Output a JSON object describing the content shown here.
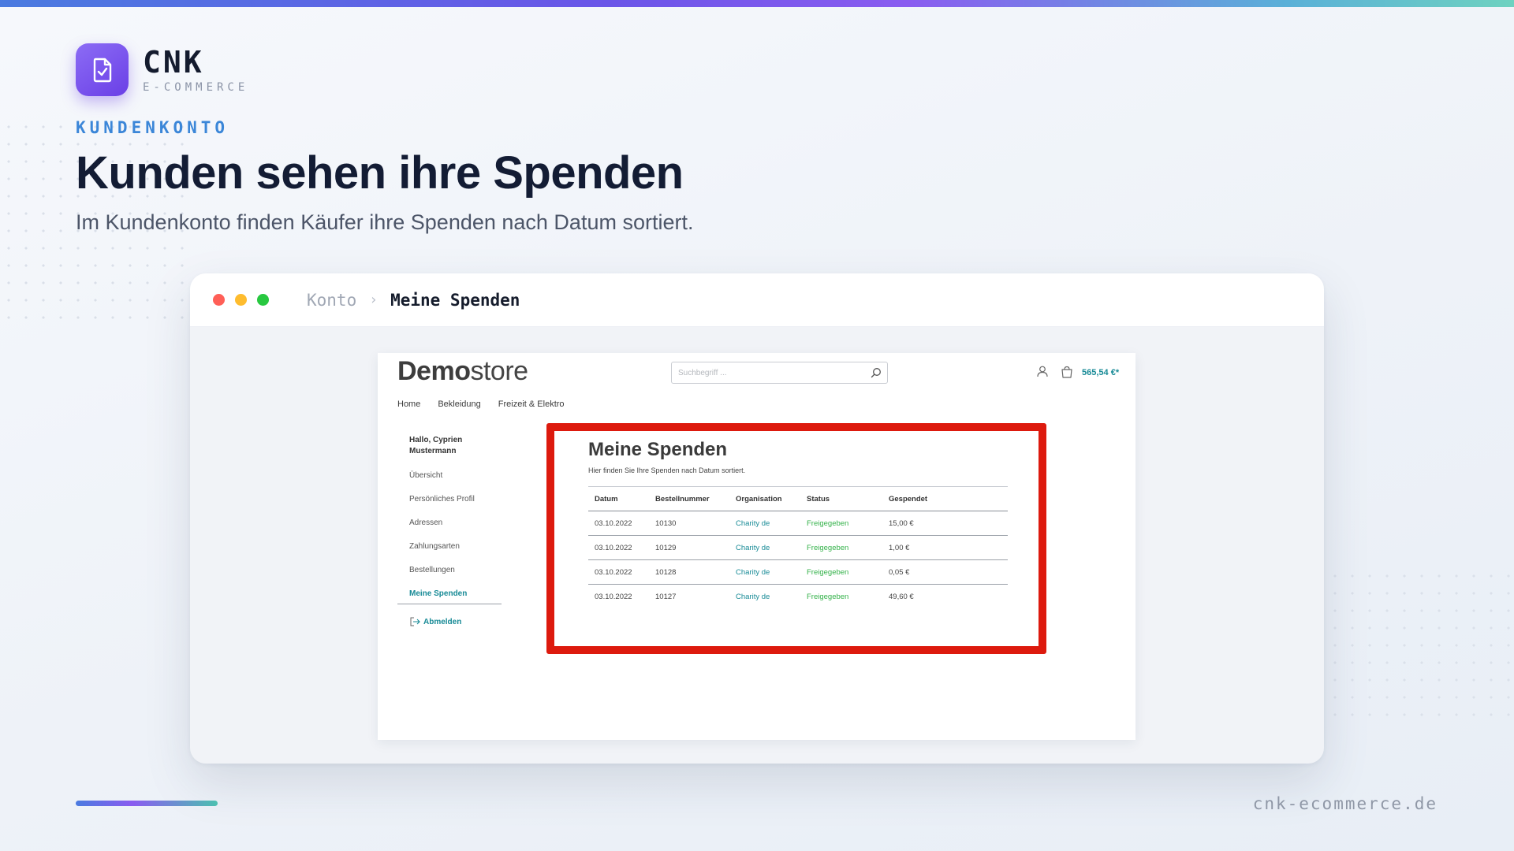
{
  "brand": {
    "name": "CNK",
    "tagline": "E-COMMERCE"
  },
  "hero": {
    "eyebrow": "KUNDENKONTO",
    "title": "Kunden sehen ihre Spenden",
    "subtitle": "Im Kundenkonto finden Käufer ihre Spenden nach Datum sortiert."
  },
  "window": {
    "breadcrumb": {
      "parent": "Konto",
      "separator": "›",
      "current": "Meine Spenden"
    }
  },
  "shop": {
    "logo_bold": "Demo",
    "logo_light": "store",
    "search_placeholder": "Suchbegriff ...",
    "cart_total": "565,54 €*",
    "nav": [
      "Home",
      "Bekleidung",
      "Freizeit & Elektro"
    ],
    "greeting": "Hallo, Cyprien Mustermann",
    "account_menu": [
      "Übersicht",
      "Persönliches Profil",
      "Adressen",
      "Zahlungsarten",
      "Bestellungen",
      "Meine Spenden"
    ],
    "logout": "Abmelden"
  },
  "donations": {
    "title": "Meine Spenden",
    "subtitle": "Hier finden Sie Ihre Spenden nach Datum sortiert.",
    "columns": [
      "Datum",
      "Bestellnummer",
      "Organisation",
      "Status",
      "Gespendet"
    ],
    "rows": [
      [
        "03.10.2022",
        "10130",
        "Charity de",
        "Freigegeben",
        "15,00 €"
      ],
      [
        "03.10.2022",
        "10129",
        "Charity de",
        "Freigegeben",
        "1,00 €"
      ],
      [
        "03.10.2022",
        "10128",
        "Charity de",
        "Freigegeben",
        "0,05 €"
      ],
      [
        "03.10.2022",
        "10127",
        "Charity de",
        "Freigegeben",
        "49,60 €"
      ]
    ]
  },
  "footer": {
    "url": "cnk-ecommerce.de"
  },
  "colors": {
    "accent": "#3b86d8",
    "brand_purple": "#6a3fe6",
    "shop_teal": "#178a96",
    "status_green": "#34b24a",
    "highlight_red": "#dd1a0e"
  }
}
